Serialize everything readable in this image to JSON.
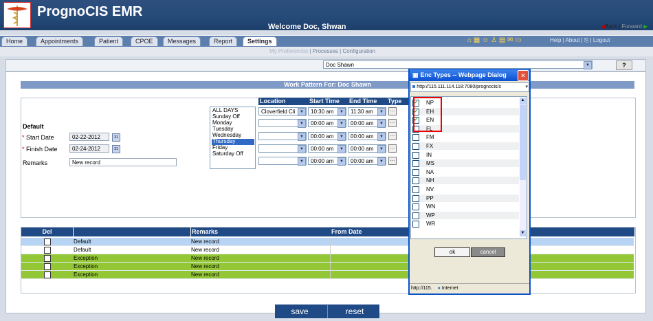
{
  "header": {
    "app_name": "PrognoCIS EMR",
    "welcome": "Welcome Doc, Shwan",
    "back": "Back |",
    "forward": "Forward"
  },
  "tabs": [
    "Home",
    "Appointments",
    "Patient",
    "CPOE",
    "Messages",
    "Report",
    "Settings"
  ],
  "top_links": "Help | About | ⎘ | Logout",
  "subnav": {
    "prefs": "My Preferences",
    "processes": "Processes",
    "configuration": "Configuration"
  },
  "provider": {
    "selected": "Doc Shawn",
    "help": "?"
  },
  "work_pattern": {
    "title": "Work Pattern For: Doc Shawn"
  },
  "form": {
    "section": "Default",
    "start_label": "Start Date",
    "start_value": "02-22-2012",
    "finish_label": "Finish Date",
    "finish_value": "02-24-2012",
    "remarks_label": "Remarks",
    "remarks_value": "New record"
  },
  "days": [
    "ALL DAYS",
    "Sunday Off",
    "Monday",
    "Tuesday",
    "Wednesday",
    "Thursday",
    "Friday",
    "Saturday Off"
  ],
  "columns": {
    "location": "Location",
    "start": "Start Time",
    "end": "End Time",
    "type": "Type"
  },
  "slots": [
    {
      "location": "Cloverfield Cli",
      "start": "10:30 am",
      "end": "11:30 am"
    },
    {
      "location": "",
      "start": "00:00 am",
      "end": "00:00 am"
    },
    {
      "location": "",
      "start": "00:00 am",
      "end": "00:00 am"
    },
    {
      "location": "",
      "start": "00:00 am",
      "end": "00:00 am"
    },
    {
      "location": "",
      "start": "00:00 am",
      "end": "00:00 am"
    }
  ],
  "grid": {
    "headers": {
      "del": "Del",
      "remarks": "Remarks",
      "from": "From Date"
    },
    "rows": [
      {
        "type": "Default",
        "remarks": "New record",
        "color": "#b7d4f4"
      },
      {
        "type": "Default",
        "remarks": "New record",
        "color": "#ffffff"
      },
      {
        "type": "Exception",
        "remarks": "New record",
        "color": "#94c735"
      },
      {
        "type": "Exception",
        "remarks": "New record",
        "color": "#94c735"
      },
      {
        "type": "Exception",
        "remarks": "New record",
        "color": "#94c735"
      }
    ]
  },
  "buttons": {
    "save": "save",
    "reset": "reset"
  },
  "dialog": {
    "title": "Enc Types -- Webpage Dialog",
    "address": "http://115.111.114.118:7080/prognocis/s",
    "items": [
      {
        "code": "NP",
        "checked": true
      },
      {
        "code": "EH",
        "checked": true
      },
      {
        "code": "EN",
        "checked": true
      },
      {
        "code": "FL",
        "checked": false
      },
      {
        "code": "FM",
        "checked": false
      },
      {
        "code": "FX",
        "checked": false
      },
      {
        "code": "IN",
        "checked": false
      },
      {
        "code": "MS",
        "checked": false
      },
      {
        "code": "NA",
        "checked": false
      },
      {
        "code": "NH",
        "checked": false
      },
      {
        "code": "NV",
        "checked": false
      },
      {
        "code": "PP",
        "checked": false
      },
      {
        "code": "WN",
        "checked": false
      },
      {
        "code": "WP",
        "checked": false
      },
      {
        "code": "WR",
        "checked": false
      }
    ],
    "ok": "ok",
    "cancel": "cancel",
    "status_url": "http://115.",
    "status_zone": "Internet"
  }
}
